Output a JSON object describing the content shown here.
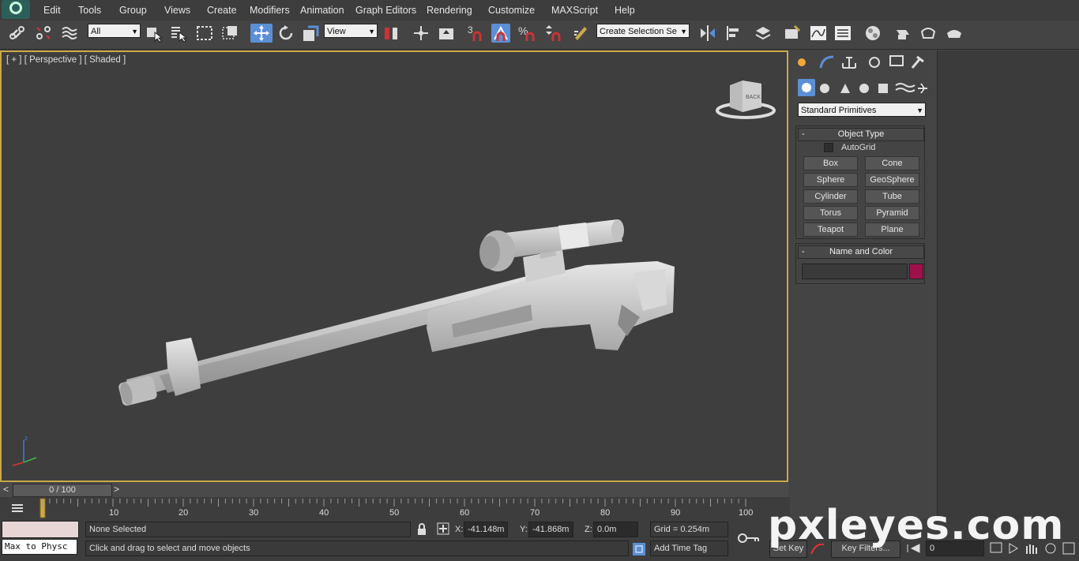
{
  "menu": [
    "Edit",
    "Tools",
    "Group",
    "Views",
    "Create",
    "Modifiers",
    "Animation",
    "Graph Editors",
    "Rendering",
    "Customize",
    "MAXScript",
    "Help"
  ],
  "toolbar": {
    "filter_value": "All",
    "refcoord_value": "View",
    "snap_label": "3",
    "selection_set_value": "Create Selection Se"
  },
  "viewport": {
    "label": "[ + ] [ Perspective ] [ Shaded ]",
    "viewcube_face": "BACK",
    "axis_z": "z"
  },
  "command_panel": {
    "category_value": "Standard Primitives",
    "object_type": {
      "title": "Object Type",
      "autogrid": "AutoGrid",
      "buttons": [
        "Box",
        "Cone",
        "Sphere",
        "GeoSphere",
        "Cylinder",
        "Tube",
        "Torus",
        "Pyramid",
        "Teapot",
        "Plane"
      ]
    },
    "name_color": {
      "title": "Name and Color",
      "name_value": "",
      "color": "#9e1049"
    }
  },
  "timeline": {
    "frame_display": "0 / 100",
    "ticks": [
      "10",
      "20",
      "30",
      "40",
      "50",
      "60",
      "70",
      "80",
      "90",
      "100"
    ]
  },
  "status": {
    "maxscript_value": "Max to Physc",
    "selection": "None Selected",
    "prompt": "Click and drag to select and move objects",
    "x_label": "X:",
    "x_value": "-41.148m",
    "y_label": "Y:",
    "y_value": "-41.868m",
    "z_label": "Z:",
    "z_value": "0.0m",
    "grid": "Grid = 0.254m",
    "add_time_tag": "Add Time Tag",
    "set_key": "Set Key",
    "key_filters": "Key Filters...",
    "frame_value": "0"
  },
  "watermark": "pxleyes.com",
  "colors": {
    "viewport_border": "#c9a94a",
    "active_tool": "#5b8fd6"
  }
}
